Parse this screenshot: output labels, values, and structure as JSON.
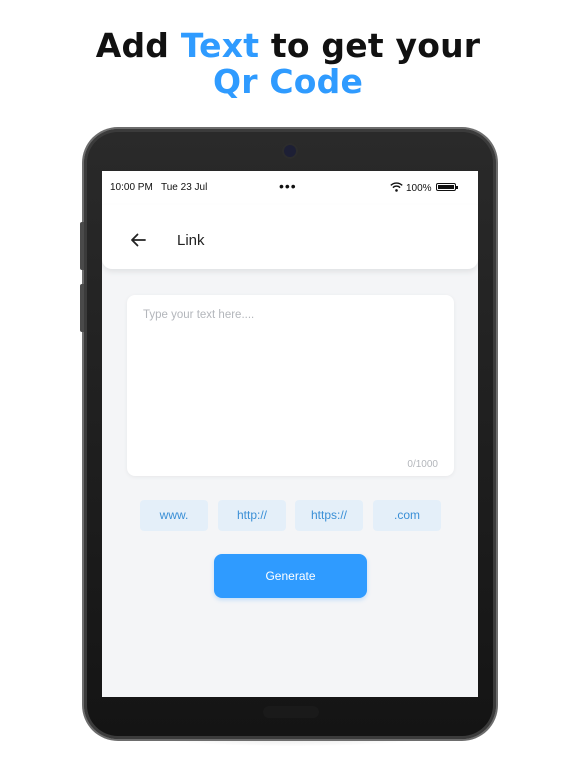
{
  "headline": {
    "part1": "Add ",
    "accent1": "Text",
    "part2": " to get your",
    "accent2": "Qr Code"
  },
  "colors": {
    "accent": "#2f9bff",
    "chip_bg": "#e4eff9",
    "chip_text": "#3a8fd6",
    "screen_bg": "#f4f5f7"
  },
  "status_bar": {
    "time": "10:00 PM",
    "date": "Tue 23 Jul",
    "dots": "•••",
    "battery": "100%"
  },
  "app_bar": {
    "back_icon": "arrow-left-icon",
    "title": "Link"
  },
  "text_input": {
    "value": "",
    "placeholder": "Type your text here....",
    "counter": "0/1000"
  },
  "chips": [
    "www.",
    "http://",
    "https://",
    ".com"
  ],
  "generate_label": "Generate"
}
